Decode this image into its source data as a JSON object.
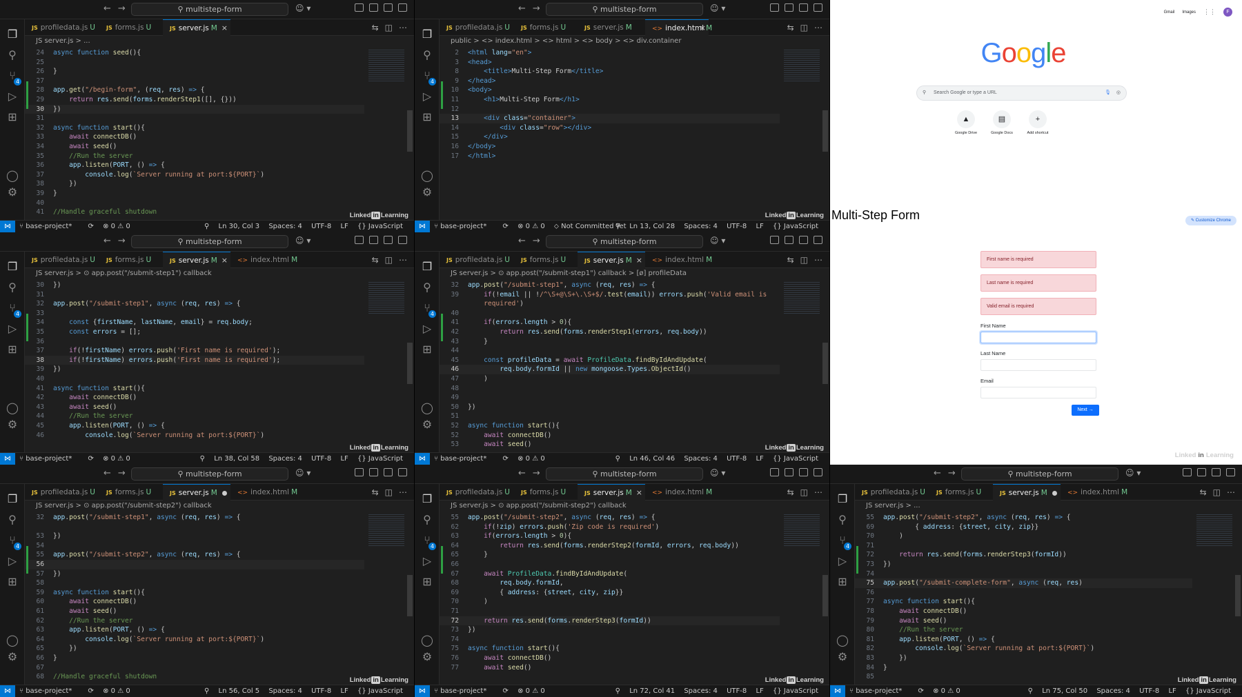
{
  "common": {
    "command_center": "multistep-form",
    "nav_back": "←",
    "nav_fwd": "→",
    "branch": "base-project*",
    "sync_icon": "⟳",
    "problems": "⊗ 0 ⚠ 0",
    "spaces": "Spaces: 4",
    "encoding": "UTF-8",
    "eol": "LF",
    "language": "{} JavaScript",
    "zoom_icon": "⚲",
    "watermark_linked": "Linked",
    "watermark_in": "in",
    "watermark_learning": "Learning"
  },
  "tiles": [
    {
      "tabs": [
        {
          "label": "profiledata.js",
          "status": "U"
        },
        {
          "label": "forms.js",
          "status": "U"
        },
        {
          "label": "server.js",
          "status": "M",
          "active": true,
          "close": "×"
        }
      ],
      "breadcrumb": "JS  server.js > ...",
      "position": "Ln 30, Col 3",
      "extra": ""
    },
    {
      "tabs": [
        {
          "label": "profiledata.js",
          "status": "U"
        },
        {
          "label": "forms.js",
          "status": "U"
        },
        {
          "label": "server.js",
          "status": "M"
        },
        {
          "label": "index.html",
          "status": "M",
          "active": true,
          "html": true,
          "close": "×"
        }
      ],
      "breadcrumb": "public > <> index.html > <> html > <> body > <> div.container",
      "position": "Ln 13, Col 28",
      "extra": "⬦ Not Committed Yet"
    },
    {
      "tabs": [
        {
          "label": "profiledata.js",
          "status": "U"
        },
        {
          "label": "forms.js",
          "status": "U"
        },
        {
          "label": "server.js",
          "status": "M",
          "active": true,
          "close": "×"
        },
        {
          "label": "index.html",
          "status": "M",
          "html": true
        }
      ],
      "breadcrumb": "JS  server.js > ⊙ app.post(\"/submit-step1\") callback",
      "position": "Ln 38, Col 58",
      "extra": ""
    },
    {
      "tabs": [
        {
          "label": "profiledata.js",
          "status": "U"
        },
        {
          "label": "forms.js",
          "status": "U"
        },
        {
          "label": "server.js",
          "status": "M",
          "active": true,
          "close": "×"
        },
        {
          "label": "index.html",
          "status": "M",
          "html": true
        }
      ],
      "breadcrumb": "JS  server.js > ⊙ app.post(\"/submit-step1\") callback > [ø] profileData",
      "position": "Ln 46, Col 46",
      "extra": ""
    },
    {
      "tabs": [
        {
          "label": "profiledata.js",
          "status": "U"
        },
        {
          "label": "forms.js",
          "status": "U"
        },
        {
          "label": "server.js",
          "status": "M",
          "active": true,
          "dirty": true
        },
        {
          "label": "index.html",
          "status": "M",
          "html": true
        }
      ],
      "breadcrumb": "JS  server.js > ⊙ app.post(\"/submit-step2\") callback",
      "position": "Ln 56, Col 5",
      "extra": ""
    },
    {
      "tabs": [
        {
          "label": "profiledata.js",
          "status": "U"
        },
        {
          "label": "forms.js",
          "status": "U"
        },
        {
          "label": "server.js",
          "status": "M",
          "active": true,
          "close": "×"
        },
        {
          "label": "index.html",
          "status": "M",
          "html": true
        }
      ],
      "breadcrumb": "JS  server.js > ⊙ app.post(\"/submit-step2\") callback",
      "position": "Ln 72, Col 41",
      "extra": ""
    },
    {
      "tabs": [
        {
          "label": "profiledata.js",
          "status": "U"
        },
        {
          "label": "forms.js",
          "status": "U"
        },
        {
          "label": "server.js",
          "status": "M",
          "active": true,
          "dirty": true
        },
        {
          "label": "index.html",
          "status": "M",
          "html": true
        }
      ],
      "breadcrumb": "JS  server.js > ...",
      "position": "Ln 75, Col 50",
      "extra": ""
    }
  ],
  "code": {
    "t1": [
      [
        "24",
        "<k>async</k> <k>function</k> <f>seed</f>(){"
      ],
      [
        "25",
        ""
      ],
      [
        "26",
        "}"
      ],
      [
        "27",
        ""
      ],
      [
        "28",
        "<v>app</v>.<f>get</f>(<s>\"/begin-form\"</s>, (<v>req</v>, <v>res</v>) <k>=></k> {"
      ],
      [
        "29",
        "    <cf>return</cf> <v>res</v>.<f>send</f>(<v>forms</v>.<f>renderStep1</f>([], {}))"
      ],
      [
        "30",
        "})",
        "cur"
      ],
      [
        "31",
        ""
      ],
      [
        "32",
        "<k>async</k> <k>function</k> <f>start</f>(){"
      ],
      [
        "33",
        "    <cf>await</cf> <f>connectDB</f>()"
      ],
      [
        "34",
        "    <cf>await</cf> <f>seed</f>()"
      ],
      [
        "35",
        "    <c>//Run the server</c>"
      ],
      [
        "36",
        "    <v>app</v>.<f>listen</f>(<v>PORT</v>, () <k>=></k> {"
      ],
      [
        "37",
        "        <v>console</v>.<f>log</f>(<s>`Server running at port:${PORT}`</s>)"
      ],
      [
        "38",
        "    })"
      ],
      [
        "39",
        "}"
      ],
      [
        "40",
        ""
      ],
      [
        "41",
        "<c>//Handle graceful shutdown</c>"
      ]
    ],
    "t2": [
      [
        "2",
        "<k>&lt;html</k> <v>lang</v>=<s>\"en\"</s><k>&gt;</k>"
      ],
      [
        "3",
        "<k>&lt;head&gt;</k>"
      ],
      [
        "8",
        "    <k>&lt;title&gt;</k>Multi-Step Form<k>&lt;/title&gt;</k>"
      ],
      [
        "9",
        "<k>&lt;/head&gt;</k>"
      ],
      [
        "10",
        "<k>&lt;body&gt;</k>"
      ],
      [
        "11",
        "    <k>&lt;h1&gt;</k>Multi-Step Form<k>&lt;/h1&gt;</k>"
      ],
      [
        "12",
        ""
      ],
      [
        "13",
        "    <k>&lt;div</k> <v>class</v>=<s>\"container\"</s><k>&gt;</k>",
        "cur"
      ],
      [
        "14",
        "        <k>&lt;div</k> <v>class</v>=<s>\"row\"</s><k>&gt;&lt;/div&gt;</k>"
      ],
      [
        "15",
        "    <k>&lt;/div&gt;</k>"
      ],
      [
        "16",
        "<k>&lt;/body&gt;</k>"
      ],
      [
        "17",
        "<k>&lt;/html&gt;</k>"
      ]
    ],
    "t3": [
      [
        "30",
        "})"
      ],
      [
        "31",
        ""
      ],
      [
        "32",
        "<v>app</v>.<f>post</f>(<s>\"/submit-step1\"</s>, <k>async</k> (<v>req</v>, <v>res</v>) <k>=></k> {"
      ],
      [
        "33",
        ""
      ],
      [
        "34",
        "    <k>const</k> {<v>firstName</v>, <v>lastName</v>, <v>email</v>} = <v>req</v>.<v>body</v>;"
      ],
      [
        "35",
        "    <k>const</k> <v>errors</v> = [];"
      ],
      [
        "36",
        ""
      ],
      [
        "37",
        "    <cf>if</cf>(!<v>firstName</v>) <v>errors</v>.<f>push</f>(<s>'First name is required'</s>);"
      ],
      [
        "38",
        "    <cf>if</cf>(!<v>firstName</v>) <v>errors</v>.<f>push</f>(<s>'First name is required'</s>);",
        "cur"
      ],
      [
        "39",
        "})"
      ],
      [
        "40",
        ""
      ],
      [
        "41",
        "<k>async</k> <k>function</k> <f>start</f>(){"
      ],
      [
        "42",
        "    <cf>await</cf> <f>connectDB</f>()"
      ],
      [
        "43",
        "    <cf>await</cf> <f>seed</f>()"
      ],
      [
        "44",
        "    <c>//Run the server</c>"
      ],
      [
        "45",
        "    <v>app</v>.<f>listen</f>(<v>PORT</v>, () <k>=></k> {"
      ],
      [
        "46",
        "        <v>console</v>.<f>log</f>(<s>`Server running at port:${PORT}`</s>)"
      ]
    ],
    "t4": [
      [
        "32",
        "<v>app</v>.<f>post</f>(<s>\"/submit-step1\"</s>, <k>async</k> (<v>req</v>, <v>res</v>) <k>=></k> {"
      ],
      [
        "39",
        "    <cf>if</cf>(!<v>email</v> || !<s>/^\\S+@\\S+\\.\\S+$/</s>.<f>test</f>(<v>email</v>)) <v>errors</v>.<f>push</f>(<s>'Valid email is</s>"
      ],
      [
        "",
        "    <s>required'</s>)"
      ],
      [
        "40",
        ""
      ],
      [
        "41",
        "    <cf>if</cf>(<v>errors</v>.<v>length</v> > <n>0</n>){"
      ],
      [
        "42",
        "        <cf>return</cf> <v>res</v>.<f>send</f>(<v>forms</v>.<f>renderStep1</f>(<v>errors</v>, <v>req</v>.<v>body</v>))"
      ],
      [
        "43",
        "    }"
      ],
      [
        "44",
        ""
      ],
      [
        "45",
        "    <k>const</k> <v>profileData</v> = <cf>await</cf> <t>ProfileData</t>.<f>findByIdAndUpdate</f>("
      ],
      [
        "46",
        "        <v>req</v>.<v>body</v>.<v>formId</v> || <k>new</k> <v>mongoose</v>.<v>Types</v>.<f>ObjectId</f>()",
        "cur"
      ],
      [
        "47",
        "    )"
      ],
      [
        "48",
        ""
      ],
      [
        "49",
        ""
      ],
      [
        "50",
        "})"
      ],
      [
        "51",
        ""
      ],
      [
        "52",
        "<k>async</k> <k>function</k> <f>start</f>(){"
      ],
      [
        "52",
        "    <cf>await</cf> <f>connectDB</f>()"
      ],
      [
        "53",
        "    <cf>await</cf> <f>seed</f>()"
      ]
    ],
    "t5": [
      [
        "32",
        "<v>app</v>.<f>post</f>(<s>\"/submit-step1\"</s>, <k>async</k> (<v>req</v>, <v>res</v>) <k>=></k> {"
      ],
      [
        "",
        ""
      ],
      [
        "53",
        "})"
      ],
      [
        "54",
        ""
      ],
      [
        "55",
        "<v>app</v>.<f>post</f>(<s>\"/submit-step2\"</s>, <k>async</k> (<v>req</v>, <v>res</v>) <k>=></k> {"
      ],
      [
        "56",
        "",
        "cur"
      ],
      [
        "57",
        "})"
      ],
      [
        "58",
        ""
      ],
      [
        "59",
        "<k>async</k> <k>function</k> <f>start</f>(){"
      ],
      [
        "60",
        "    <cf>await</cf> <f>connectDB</f>()"
      ],
      [
        "61",
        "    <cf>await</cf> <f>seed</f>()"
      ],
      [
        "62",
        "    <c>//Run the server</c>"
      ],
      [
        "63",
        "    <v>app</v>.<f>listen</f>(<v>PORT</v>, () <k>=></k> {"
      ],
      [
        "64",
        "        <v>console</v>.<f>log</f>(<s>`Server running at port:${PORT}`</s>)"
      ],
      [
        "65",
        "    })"
      ],
      [
        "66",
        "}"
      ],
      [
        "67",
        ""
      ],
      [
        "68",
        "<c>//Handle graceful shutdown</c>"
      ]
    ],
    "t6": [
      [
        "55",
        "<v>app</v>.<f>post</f>(<s>\"/submit-step2\"</s>, <k>async</k> (<v>req</v>, <v>res</v>) <k>=></k> {"
      ],
      [
        "62",
        "    <cf>if</cf>(!<v>zip</v>) <v>errors</v>.<f>push</f>(<s>'Zip code is required'</s>)"
      ],
      [
        "63",
        "    <cf>if</cf>(<v>errors</v>.<v>length</v> > <n>0</n>){"
      ],
      [
        "64",
        "        <cf>return</cf> <v>res</v>.<f>send</f>(<v>forms</v>.<f>renderStep2</f>(<v>formId</v>, <v>errors</v>, <v>req</v>.<v>body</v>))"
      ],
      [
        "65",
        "    }"
      ],
      [
        "66",
        ""
      ],
      [
        "67",
        "    <cf>await</cf> <t>ProfileData</t>.<f>findByIdAndUpdate</f>("
      ],
      [
        "68",
        "        <v>req</v>.<v>body</v>.<v>formId</v>,"
      ],
      [
        "69",
        "        { <v>address</v>: {<v>street</v>, <v>city</v>, <v>zip</v>}}"
      ],
      [
        "70",
        "    )"
      ],
      [
        "71",
        ""
      ],
      [
        "72",
        "    <cf>return</cf> <v>res</v>.<f>send</f>(<v>forms</v>.<f>renderStep3</f>(<v>formId</v>))",
        "cur"
      ],
      [
        "73",
        "})"
      ],
      [
        "74",
        ""
      ],
      [
        "75",
        "<k>async</k> <k>function</k> <f>start</f>(){"
      ],
      [
        "76",
        "    <cf>await</cf> <f>connectDB</f>()"
      ],
      [
        "77",
        "    <cf>await</cf> <f>seed</f>()"
      ]
    ],
    "t7": [
      [
        "55",
        "<v>app</v>.<f>post</f>(<s>\"/submit-step2\"</s>, <k>async</k> (<v>req</v>, <v>res</v>) <k>=></k> {"
      ],
      [
        "69",
        "        { <v>address</v>: {<v>street</v>, <v>city</v>, <v>zip</v>}}"
      ],
      [
        "70",
        "    )"
      ],
      [
        "71",
        ""
      ],
      [
        "72",
        "    <cf>return</cf> <v>res</v>.<f>send</f>(<v>forms</v>.<f>renderStep3</f>(<v>formId</v>))"
      ],
      [
        "73",
        "})"
      ],
      [
        "74",
        ""
      ],
      [
        "75",
        "<v>app</v>.<f>post</f>(<s>\"/submit-complete-form\"</s>, <k>async</k> (<v>req</v>, <v>res</v>)",
        "cur"
      ],
      [
        "76",
        ""
      ],
      [
        "77",
        "<k>async</k> <k>function</k> <f>start</f>(){"
      ],
      [
        "78",
        "    <cf>await</cf> <f>connectDB</f>()"
      ],
      [
        "79",
        "    <cf>await</cf> <f>seed</f>()"
      ],
      [
        "80",
        "    <c>//Run the server</c>"
      ],
      [
        "81",
        "    <v>app</v>.<f>listen</f>(<v>PORT</v>, () <k>=></k> {"
      ],
      [
        "82",
        "        <v>console</v>.<f>log</f>(<s>`Server running at port:${PORT}`</s>)"
      ],
      [
        "83",
        "    })"
      ],
      [
        "84",
        "}"
      ],
      [
        "85",
        ""
      ]
    ]
  },
  "browser_newtab": {
    "gmail": "Gmail",
    "images": "Images",
    "apps_icon": "⋮⋮",
    "avatar_letter": "F",
    "logo": [
      {
        "ch": "G",
        "color": "#4285f4"
      },
      {
        "ch": "o",
        "color": "#ea4335"
      },
      {
        "ch": "o",
        "color": "#fbbc05"
      },
      {
        "ch": "g",
        "color": "#4285f4"
      },
      {
        "ch": "l",
        "color": "#34a853"
      },
      {
        "ch": "e",
        "color": "#ea4335"
      }
    ],
    "search_placeholder": "Search Google or type a URL",
    "shortcuts": [
      {
        "label": "Google Drive",
        "icon": "▲"
      },
      {
        "label": "Google Docs",
        "icon": "▤"
      },
      {
        "label": "Add shortcut",
        "icon": "+"
      }
    ],
    "customize": "✎ Customize Chrome"
  },
  "form": {
    "title": "Multi-Step Form",
    "errors": [
      "First name is required",
      "Last name is required",
      "Valid email is required"
    ],
    "first_label": "First Name",
    "last_label": "Last Name",
    "email_label": "Email",
    "next": "Next →"
  }
}
